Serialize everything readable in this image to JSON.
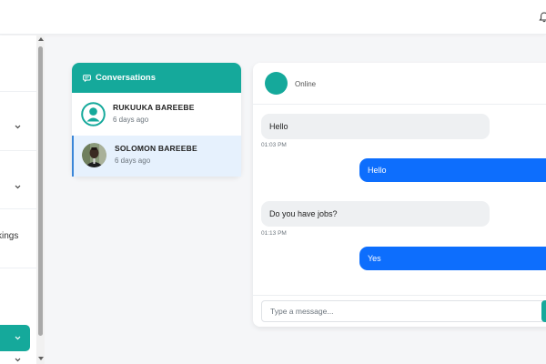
{
  "colors": {
    "accent": "#15a99b",
    "outgoing": "#0d6efd",
    "incoming": "#eef0f2",
    "active_item": "#e6f1fd"
  },
  "topbar": {
    "icon": "bell-icon"
  },
  "sidebar": {
    "items": [
      {
        "label": "",
        "icon": "chevron-down-icon"
      },
      {
        "label": "",
        "icon": "chevron-down-icon"
      },
      {
        "label": "kings",
        "icon": ""
      },
      {
        "label": "",
        "icon": "chevron-down-icon",
        "active": true
      },
      {
        "label": "",
        "icon": ""
      }
    ]
  },
  "conversations": {
    "title": "Conversations",
    "icon": "chat-icon",
    "items": [
      {
        "name": "RUKUUKA BAREEBE",
        "time": "6 days ago",
        "avatar": "user-placeholder-icon"
      },
      {
        "name": "SOLOMON BAREEBE",
        "time": "6 days ago",
        "avatar": "user-photo",
        "active": true
      }
    ]
  },
  "chat": {
    "status": "Online",
    "messages": [
      {
        "direction": "in",
        "text": "Hello",
        "time": "01:03 PM"
      },
      {
        "direction": "out",
        "text": "Hello"
      },
      {
        "direction": "in",
        "text": "Do you have jobs?",
        "time": "01:13 PM"
      },
      {
        "direction": "out",
        "text": "Yes"
      }
    ],
    "input": {
      "placeholder": "Type a message...",
      "value": ""
    }
  }
}
